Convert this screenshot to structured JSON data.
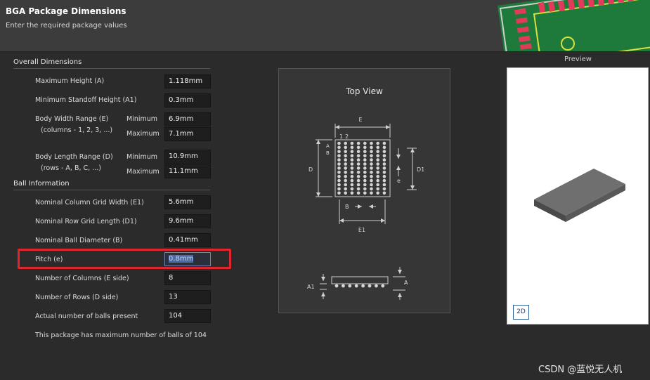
{
  "header": {
    "title": "BGA Package Dimensions",
    "subtitle": "Enter the required package values"
  },
  "overall": {
    "section_label": "Overall Dimensions",
    "max_height": {
      "label": "Maximum Height (A)",
      "value": "1.118mm"
    },
    "min_standoff": {
      "label": "Minimum Standoff Height (A1)",
      "value": "0.3mm"
    },
    "body_width": {
      "label_line1": "Body Width Range (E)",
      "label_line2": "(columns - 1, 2, 3, ...)",
      "min_label": "Minimum",
      "min_value": "6.9mm",
      "max_label": "Maximum",
      "max_value": "7.1mm"
    },
    "body_length": {
      "label_line1": "Body Length Range (D)",
      "label_line2": "(rows - A, B, C, ...)",
      "min_label": "Minimum",
      "min_value": "10.9mm",
      "max_label": "Maximum",
      "max_value": "11.1mm"
    }
  },
  "ball": {
    "section_label": "Ball Information",
    "col_grid_width": {
      "label": "Nominal Column Grid Width (E1)",
      "value": "5.6mm"
    },
    "row_grid_length": {
      "label": "Nominal Row Grid Length (D1)",
      "value": "9.6mm"
    },
    "ball_diameter": {
      "label": "Nominal Ball Diameter (B)",
      "value": "0.41mm"
    },
    "pitch": {
      "label": "Pitch (e)",
      "value": "0.8mm"
    },
    "num_columns": {
      "label": "Number of Columns (E side)",
      "value": "8"
    },
    "num_rows": {
      "label": "Number of Rows (D side)",
      "value": "13"
    },
    "actual_balls": {
      "label": "Actual number of balls present",
      "value": "104"
    },
    "note": "This package has maximum number of balls of 104"
  },
  "top_view": {
    "title": "Top View",
    "labels": {
      "E": "E",
      "col_1": "1",
      "col_2": "2",
      "row_A": "A",
      "row_B": "B",
      "D": "D",
      "D1": "D1",
      "e": "e",
      "B": "B",
      "E1": "E1",
      "A1": "A1",
      "A": "A"
    }
  },
  "preview": {
    "label": "Preview",
    "toggle_2d": "2D"
  },
  "watermark": "CSDN @蓝悦无人机",
  "colors": {
    "background": "#2b2b2b",
    "header": "#3c3c3c",
    "highlight_border": "#e0262d",
    "pcb_pad": "#e23a5a",
    "pcb_outline": "#d8e040",
    "pcb_board": "#1e7a3a",
    "package_top": "#6f6f6f"
  },
  "icons": [
    "pcb-thumbnail",
    "dimension-arrow-icon"
  ]
}
